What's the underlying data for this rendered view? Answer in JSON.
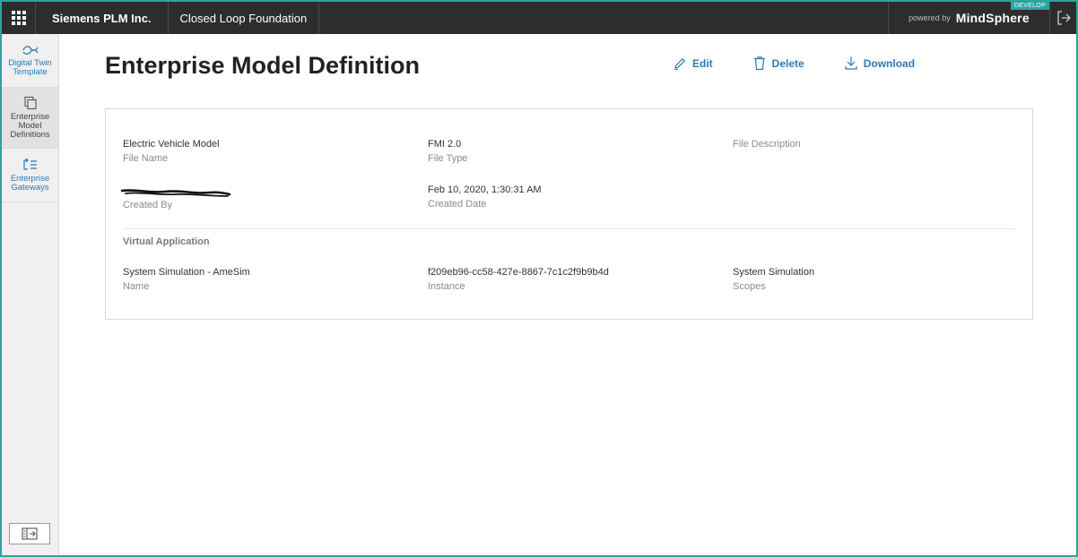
{
  "topbar": {
    "tenant": "Siemens PLM Inc.",
    "app_name": "Closed Loop Foundation",
    "powered_by": "powered by",
    "brand": "MindSphere",
    "badge": "DEVELOP",
    "icons": {
      "launcher": "app-grid-icon",
      "logout": "logout-icon"
    }
  },
  "sidebar": {
    "items": [
      {
        "label": "Digital Twin\nTemplate",
        "icon": "digital-twin-icon",
        "active": false
      },
      {
        "label": "Enterprise\nModel\nDefinitions",
        "icon": "copy-icon",
        "active": true
      },
      {
        "label": "Enterprise\nGateways",
        "icon": "gateway-list-icon",
        "active": false
      }
    ],
    "collapse_icon": "sidebar-collapse-icon"
  },
  "page": {
    "title": "Enterprise Model Definition",
    "actions": {
      "edit": "Edit",
      "delete": "Delete",
      "download": "Download"
    }
  },
  "details": {
    "file_name": {
      "value": "Electric Vehicle Model",
      "label": "File Name"
    },
    "file_type": {
      "value": "FMI 2.0",
      "label": "File Type"
    },
    "file_description": {
      "value": "",
      "label": "File Description"
    },
    "created_by": {
      "value": "",
      "label": "Created By"
    },
    "created_date": {
      "value": "Feb 10, 2020, 1:30:31 AM",
      "label": "Created Date"
    }
  },
  "virtual_application": {
    "section_title": "Virtual Application",
    "name": {
      "value": "System Simulation - AmeSim",
      "label": "Name"
    },
    "instance": {
      "value": "f209eb96-cc58-427e-8867-7c1c2f9b9b4d",
      "label": "Instance"
    },
    "scopes": {
      "value": "System Simulation",
      "label": "Scopes"
    }
  },
  "colors": {
    "accent": "#2a7ab8",
    "topbar": "#2d2d2d",
    "frame": "#2aa5a0"
  }
}
